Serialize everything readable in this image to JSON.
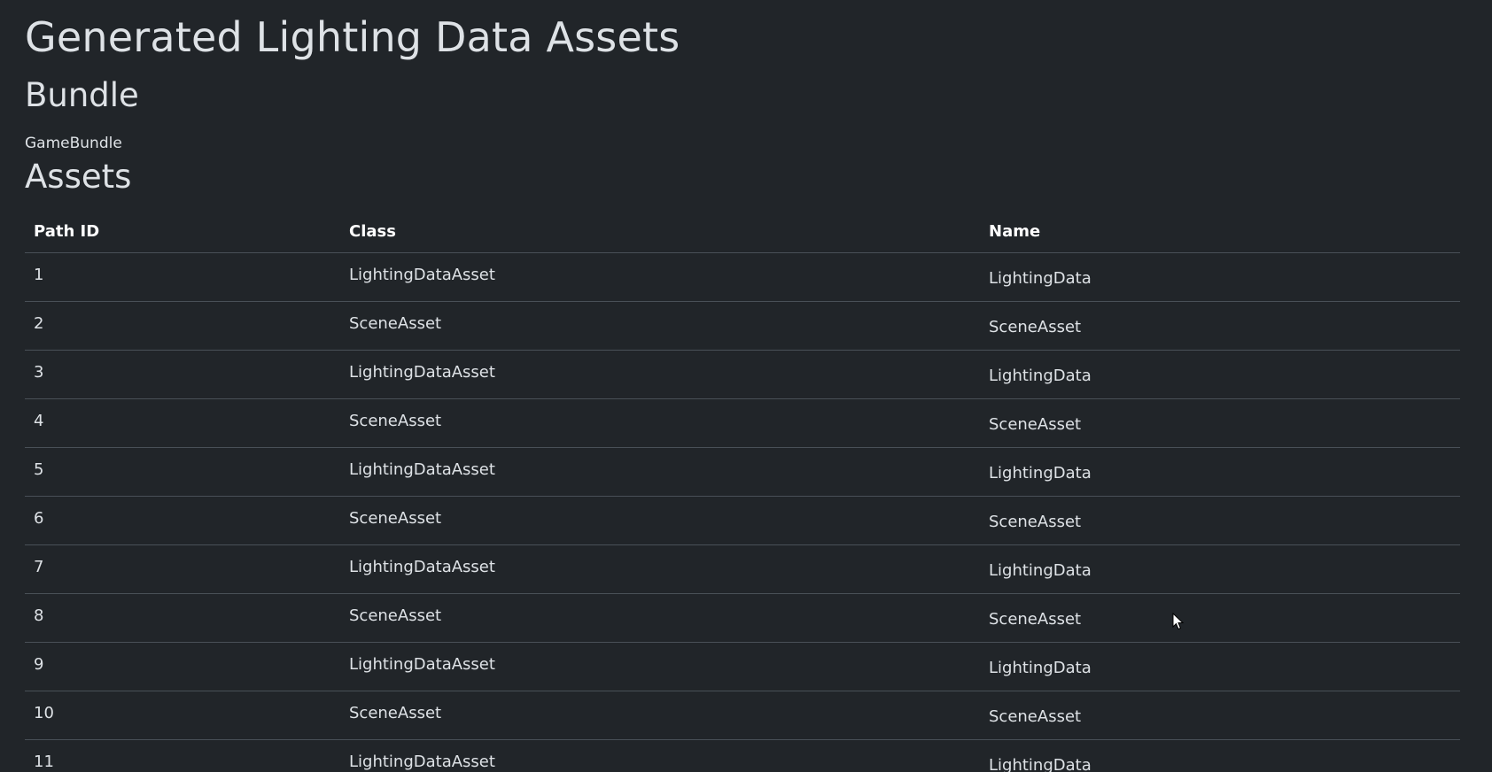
{
  "page": {
    "title": "Generated Lighting Data Assets"
  },
  "bundle": {
    "heading": "Bundle",
    "name": "GameBundle"
  },
  "assets": {
    "heading": "Assets",
    "columns": [
      "Path ID",
      "Class",
      "Name"
    ],
    "rows": [
      {
        "path_id": "1",
        "class": "LightingDataAsset",
        "name": "LightingData"
      },
      {
        "path_id": "2",
        "class": "SceneAsset",
        "name": "SceneAsset"
      },
      {
        "path_id": "3",
        "class": "LightingDataAsset",
        "name": "LightingData"
      },
      {
        "path_id": "4",
        "class": "SceneAsset",
        "name": "SceneAsset"
      },
      {
        "path_id": "5",
        "class": "LightingDataAsset",
        "name": "LightingData"
      },
      {
        "path_id": "6",
        "class": "SceneAsset",
        "name": "SceneAsset"
      },
      {
        "path_id": "7",
        "class": "LightingDataAsset",
        "name": "LightingData"
      },
      {
        "path_id": "8",
        "class": "SceneAsset",
        "name": "SceneAsset"
      },
      {
        "path_id": "9",
        "class": "LightingDataAsset",
        "name": "LightingData"
      },
      {
        "path_id": "10",
        "class": "SceneAsset",
        "name": "SceneAsset"
      },
      {
        "path_id": "11",
        "class": "LightingDataAsset",
        "name": "LightingData"
      }
    ]
  },
  "colors": {
    "background": "#212529",
    "text": "#dee2e6",
    "divider": "#495057"
  },
  "icons": {
    "cursor": "mouse-pointer-icon"
  }
}
